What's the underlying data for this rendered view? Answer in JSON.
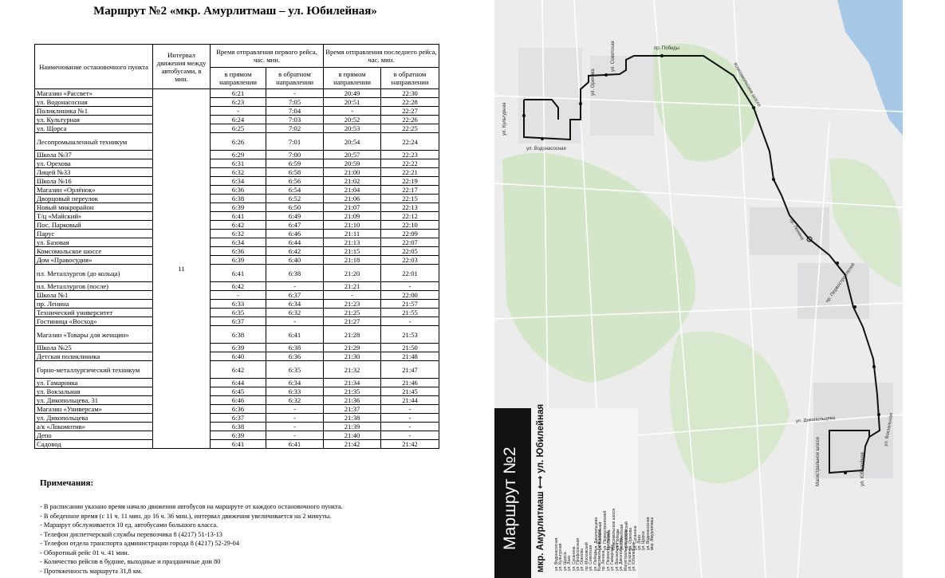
{
  "title": "Маршрут №2 «мкр. Амурлитмаш – ул. Юбилейная»",
  "table": {
    "headers": {
      "name": "Наименование остановочного пункта",
      "interval": "Интервал движения между автобусами, в мин.",
      "first": "Время отправления первого рейса, час. мин.",
      "last": "Время отправления последнего рейса, час. мин.",
      "forward": "в прямом направлении",
      "back": "в обратном направлении"
    },
    "interval_value": "11",
    "rows": [
      {
        "name": "Магазин «Рассвет»",
        "f1": "6:21",
        "b1": "-",
        "f2": "20:49",
        "b2": "22:30"
      },
      {
        "name": "ул. Водонасосная",
        "f1": "6:23",
        "b1": "7:05",
        "f2": "20:51",
        "b2": "22:28"
      },
      {
        "name": "Поликлиника №1",
        "f1": "-",
        "b1": "7:04",
        "f2": "-",
        "b2": "22:27"
      },
      {
        "name": "ул. Культурная",
        "f1": "6:24",
        "b1": "7:03",
        "f2": "20:52",
        "b2": "22:26"
      },
      {
        "name": "ул. Щорса",
        "f1": "6:25",
        "b1": "7:02",
        "f2": "20:53",
        "b2": "22:25"
      },
      {
        "name": "Лесопромышленный техникум",
        "f1": "6:26",
        "b1": "7:01",
        "f2": "20:54",
        "b2": "22:24"
      },
      {
        "name": "Школа №37",
        "f1": "6:29",
        "b1": "7:00",
        "f2": "20:57",
        "b2": "22:23"
      },
      {
        "name": "ул. Орехова",
        "f1": "6:31",
        "b1": "6:59",
        "f2": "20:59",
        "b2": "22:22"
      },
      {
        "name": "Лицей №33",
        "f1": "6:32",
        "b1": "6:58",
        "f2": "21:00",
        "b2": "22:21"
      },
      {
        "name": "Школа №16",
        "f1": "6:34",
        "b1": "6:56",
        "f2": "21:02",
        "b2": "22:19"
      },
      {
        "name": "Магазин «Орлёнок»",
        "f1": "6:36",
        "b1": "6:54",
        "f2": "21:04",
        "b2": "22:17"
      },
      {
        "name": "Дворцовый переулок",
        "f1": "6:38",
        "b1": "6:52",
        "f2": "21:06",
        "b2": "22:15"
      },
      {
        "name": "Новый микрорайон",
        "f1": "6:39",
        "b1": "6:50",
        "f2": "21:07",
        "b2": "22:13"
      },
      {
        "name": "Т/ц «Майский»",
        "f1": "6:41",
        "b1": "6:49",
        "f2": "21:09",
        "b2": "22:12"
      },
      {
        "name": "Пос. Парковый",
        "f1": "6:42",
        "b1": "6:47",
        "f2": "21:10",
        "b2": "22:10"
      },
      {
        "name": "Парус",
        "f1": "6:32",
        "b1": "6:46",
        "f2": "21:11",
        "b2": "22:09"
      },
      {
        "name": "ул. Базовая",
        "f1": "6:34",
        "b1": "6:44",
        "f2": "21:13",
        "b2": "22:07"
      },
      {
        "name": "Комсомольское шоссе",
        "f1": "6:36",
        "b1": "6:42",
        "f2": "21:15",
        "b2": "22:05"
      },
      {
        "name": "Дом «Правосудия»",
        "f1": "6:39",
        "b1": "6:40",
        "f2": "21:18",
        "b2": "22:03"
      },
      {
        "name": "пл. Металлургов (до кольца)",
        "f1": "6:41",
        "b1": "6:38",
        "f2": "21:20",
        "b2": "22:01"
      },
      {
        "name": "пл. Металлургов (после)",
        "f1": "6:42",
        "b1": "-",
        "f2": "21:21",
        "b2": "-"
      },
      {
        "name": "Школа №1",
        "f1": "-",
        "b1": "6:37",
        "f2": "-",
        "b2": "22:00"
      },
      {
        "name": "пр. Ленина",
        "f1": "6:33",
        "b1": "6:34",
        "f2": "21:23",
        "b2": "21:57"
      },
      {
        "name": "Технический университет",
        "f1": "6:35",
        "b1": "6:32",
        "f2": "21:25",
        "b2": "21:55"
      },
      {
        "name": "Гостиница «Восход»",
        "f1": "6:37",
        "b1": "-",
        "f2": "21:27",
        "b2": "-"
      },
      {
        "name": "Магазин «Товары для женщин»",
        "f1": "6:38",
        "b1": "6:41",
        "f2": "21:28",
        "b2": "21:53"
      },
      {
        "name": "Школа №25",
        "f1": "6:39",
        "b1": "6:38",
        "f2": "21:29",
        "b2": "21:50"
      },
      {
        "name": "Детская поликлиника",
        "f1": "6:40",
        "b1": "6:36",
        "f2": "21:30",
        "b2": "21:48"
      },
      {
        "name": "Горно-металлургический техникум",
        "f1": "6:42",
        "b1": "6:35",
        "f2": "21:32",
        "b2": "21:47"
      },
      {
        "name": "ул. Гамарника",
        "f1": "6:44",
        "b1": "6:34",
        "f2": "21:34",
        "b2": "21:46"
      },
      {
        "name": "ул. Вокзальная",
        "f1": "6:45",
        "b1": "6:33",
        "f2": "21:35",
        "b2": "21:45"
      },
      {
        "name": "ул. Дикопольцева, 31",
        "f1": "6:46",
        "b1": "6:32",
        "f2": "21:36",
        "b2": "21:44"
      },
      {
        "name": "Магазин «Универсам»",
        "f1": "6:36",
        "b1": "-",
        "f2": "21:37",
        "b2": "-"
      },
      {
        "name": "ул. Дикопольцева",
        "f1": "6:37",
        "b1": "-",
        "f2": "21:38",
        "b2": "-"
      },
      {
        "name": "а/к «Локомотив»",
        "f1": "6:38",
        "b1": "-",
        "f2": "21:39",
        "b2": "-"
      },
      {
        "name": "Депо",
        "f1": "6:39",
        "b1": "-",
        "f2": "21:40",
        "b2": "-"
      },
      {
        "name": "Садовод",
        "f1": "6:41",
        "b1": "6:41",
        "f2": "21:42",
        "b2": "21:42"
      }
    ]
  },
  "notes": {
    "heading": "Примечания:",
    "items": [
      "- В расписании указано время начало движения автобусов на маршруте от каждого остановочного пункта.",
      "- В обеденное время (с 11 ч. 11 мин. до 16 ч. 36 мин.), интервал движения увеличивается на 2 минуты.",
      "- Маршрут обслуживается 10 ед. автобусами большого класса.",
      "- Телефон диспетчерской службы перевозчика 8 (4217) 51-13-13",
      "- Телефон отдела транспорта администрации города 8 (4217) 52-29-04",
      "- Оборотный рейс 01 ч. 41 мин.",
      "- Количество рейсов в будние, выходные и праздничные дни 80",
      "- Протяженность маршрута 31,8 км."
    ]
  },
  "map": {
    "title": "Маршрут №2",
    "subtitle": "мкр. Амурлитмаш ⟷ ул. Юбилейная",
    "street_labels": [
      "ул. Культурная",
      "ул. Орехова",
      "ул. Советская",
      "пр. Победы",
      "Комсомольское шоссе",
      "ул. Водонасосная",
      "пр. Первостроителей",
      "ул. Дикопольцева",
      "ул. Вокзальная",
      "Магистральное шоссе",
      "ул. Юбилейная",
      "пр. Ленина"
    ],
    "stops_col1": [
      "ул. Водонасосная",
      "ул. Культурная",
      "ул. Щорса",
      "ул. Лазо",
      "ул. Сусанина",
      "ул. Профсоюзная",
      "ул. Орехова",
      "пр. Московский",
      "ул. Советская",
      "ул. Победы",
      "Комсомольское шоссе",
      "пр. Ленина",
      "ул. Первостроителей",
      "ул. Гамарника",
      "ул. Вокзальная",
      "ул. Дикопольцева",
      "Магистральное шоссе",
      "ул. Гагарина",
      "ул. Юбилейная"
    ],
    "stops_col2": [
      "ул. Дикопольцева",
      "ул. Вокзальная",
      "ул. Первостроителей",
      "пр. Ленина",
      "Комсомольское шоссе",
      "ул. Победы",
      "ул. Советская",
      "пр. Московский",
      "ул. Орехова",
      "ул. Сусанина",
      "ул. Лазо",
      "ул. Щорса",
      "ул. Водонасосная",
      "мкр. Амурлитмаш"
    ],
    "colors": {
      "route": "#111111",
      "green": "#cfe3c4",
      "water": "#a8c8e8",
      "road": "#ffffff",
      "block": "#dcdcde"
    }
  }
}
